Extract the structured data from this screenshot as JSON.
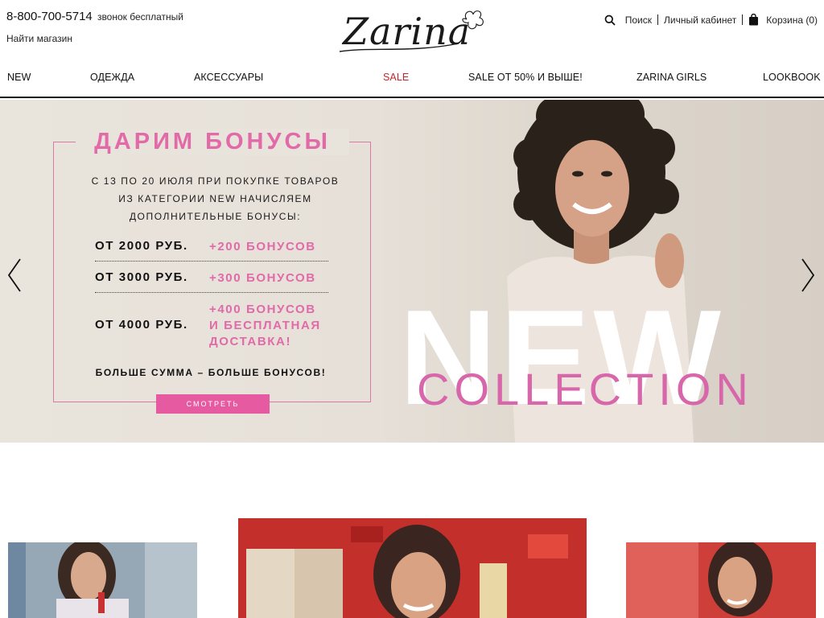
{
  "header": {
    "phone": "8-800-700-5714",
    "phone_note": "звонок бесплатный",
    "find_store": "Найти магазин",
    "logo_text": "Zarina",
    "search_label": "Поиск",
    "account_label": "Личный кабинет",
    "cart_label": "Корзина (0)"
  },
  "nav": {
    "items": [
      "NEW",
      "ОДЕЖДА",
      "АКСЕССУАРЫ",
      "SALE",
      "SALE ОТ 50% И ВЫШЕ!",
      "ZARINA GIRLS",
      "LOOKBOOK"
    ]
  },
  "hero": {
    "title": "ДАРИМ БОНУСЫ",
    "description": [
      "С 13 ПО 20 ИЮЛЯ ПРИ ПОКУПКЕ ТОВАРОВ",
      "ИЗ КАТЕГОРИИ NEW НАЧИСЛЯЕМ",
      "ДОПОЛНИТЕЛЬНЫЕ БОНУСЫ:"
    ],
    "tiers": [
      {
        "amount": "ОТ 2000 РУБ.",
        "bonus": [
          "+200 БОНУСОВ"
        ]
      },
      {
        "amount": "ОТ 3000 РУБ.",
        "bonus": [
          "+300 БОНУСОВ"
        ]
      },
      {
        "amount": "ОТ 4000 РУБ.",
        "bonus": [
          "+400 БОНУСОВ",
          "И БЕСПЛАТНАЯ",
          "ДОСТАВКА!"
        ]
      }
    ],
    "footer": "БОЛЬШЕ СУММА – БОЛЬШЕ БОНУСОВ!",
    "button": "СМОТРЕТЬ",
    "big_word": "NEW",
    "collection_word": "COLLECTION"
  },
  "colors": {
    "accent_pink": "#e26aa8",
    "sale_red": "#c0272d",
    "hero_bg": "#e8e3db"
  },
  "icons": {
    "search": "search-icon",
    "cart": "cart-icon",
    "prev": "chevron-left-icon",
    "next": "chevron-right-icon"
  }
}
